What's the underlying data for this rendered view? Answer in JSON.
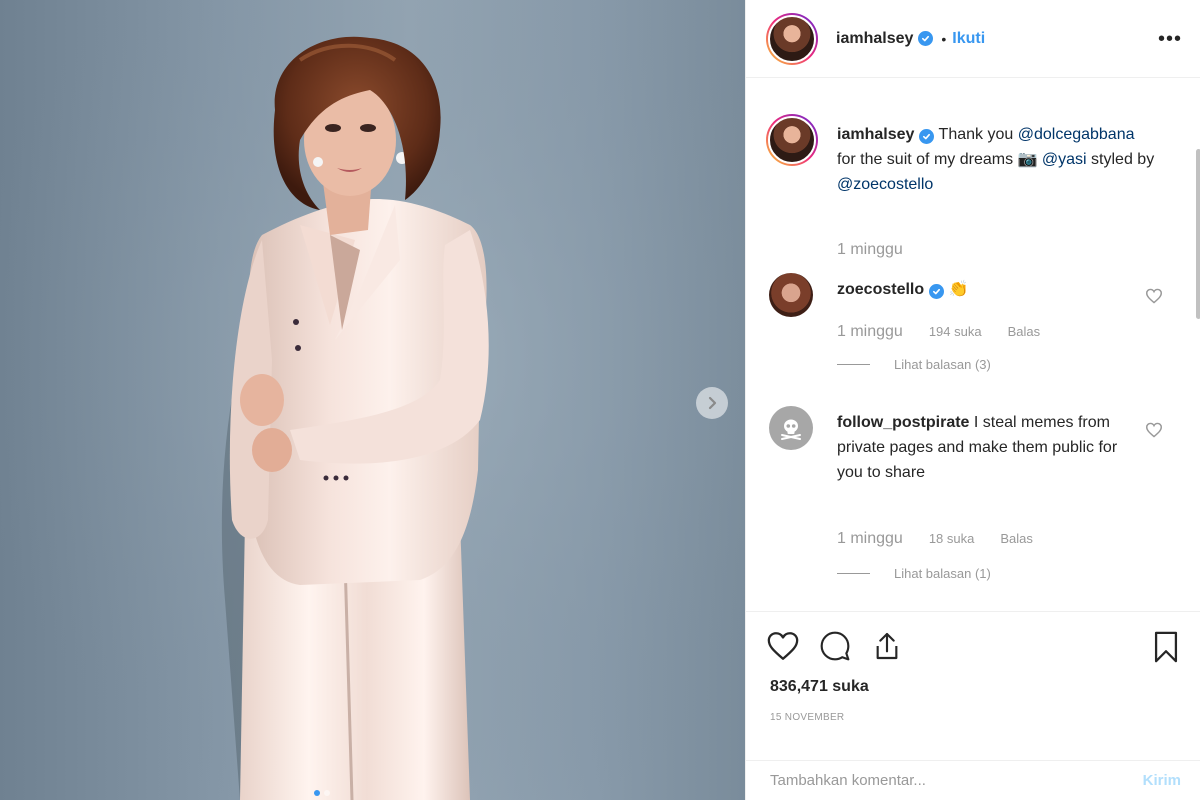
{
  "post": {
    "username": "iamhalsey",
    "follow_label": "Ikuti",
    "follow_separator": "•",
    "more_label": "•••"
  },
  "caption": {
    "username": "iamhalsey",
    "text_1": "Thank you",
    "mention_1": "@dolcegabbana",
    "text_2": "for the suit of my dreams",
    "camera_emoji": "📷",
    "mention_2": "@yasi",
    "text_3": "styled by",
    "mention_3": "@zoecostello",
    "time": "1 minggu"
  },
  "comments": [
    {
      "username": "zoecostello",
      "emoji": "👏",
      "text": "",
      "time": "1 minggu",
      "likes": "194 suka",
      "reply_label": "Balas",
      "view_replies": "Lihat balasan (3)"
    },
    {
      "username": "follow_postpirate",
      "text": "I steal memes from private pages and make them public for you to share",
      "time": "1 minggu",
      "likes": "18 suka",
      "reply_label": "Balas",
      "view_replies": "Lihat balasan (1)"
    }
  ],
  "actions": {
    "likes": "836,471 suka",
    "date": "15 NOVEMBER"
  },
  "add_comment": {
    "placeholder": "Tambahkan komentar...",
    "send_label": "Kirim"
  },
  "colors": {
    "accent": "#3897f0",
    "mention": "#003569",
    "muted": "#999999",
    "send_disabled": "#b2dffc"
  },
  "icons": [
    "chevron-right-icon",
    "verified-badge-icon",
    "more-options-icon",
    "heart-icon",
    "comment-icon",
    "share-icon",
    "bookmark-icon",
    "skull-icon"
  ]
}
